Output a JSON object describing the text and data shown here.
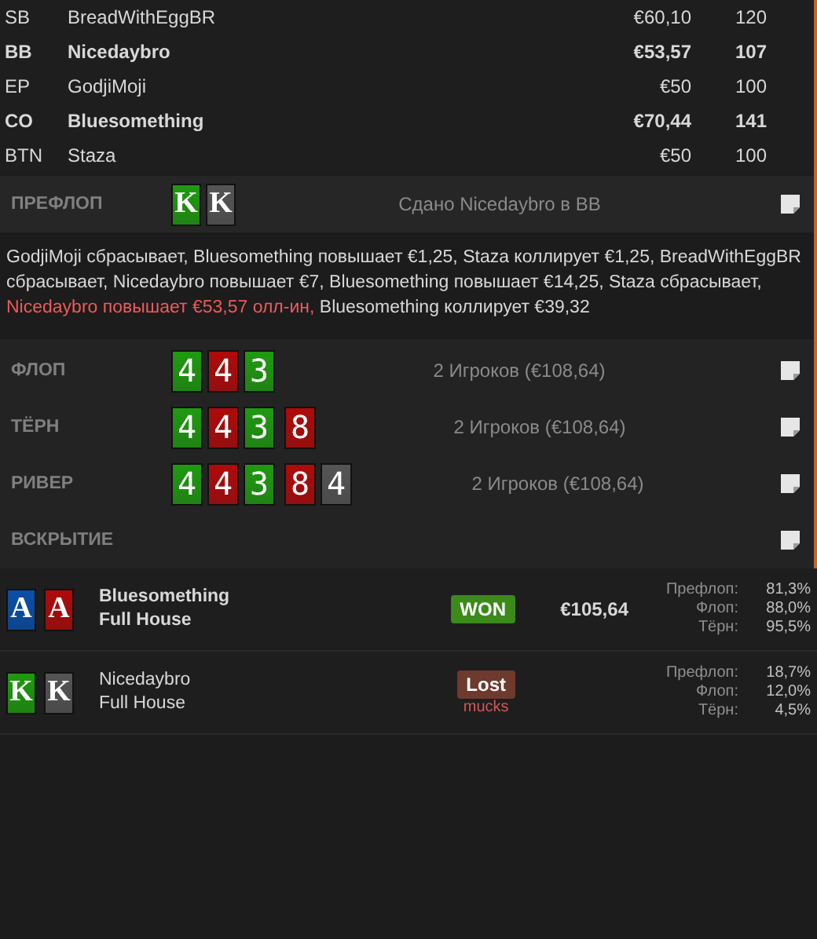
{
  "players": [
    {
      "position": "SB",
      "name": "BreadWithEggBR",
      "stack": "€60,10",
      "bb": "120",
      "highlighted": false
    },
    {
      "position": "BB",
      "name": "Nicedaybro",
      "stack": "€53,57",
      "bb": "107",
      "highlighted": true
    },
    {
      "position": "EP",
      "name": "GodjiMoji",
      "stack": "€50",
      "bb": "100",
      "highlighted": false
    },
    {
      "position": "CO",
      "name": "Bluesomething",
      "stack": "€70,44",
      "bb": "141",
      "highlighted": true
    },
    {
      "position": "BTN",
      "name": "Staza",
      "stack": "€50",
      "bb": "100",
      "highlighted": false
    }
  ],
  "preflop": {
    "label": "ПРЕФЛОП",
    "cards": [
      {
        "rank": "K",
        "color": "#1f9a10"
      },
      {
        "rank": "K",
        "color": "#555555"
      }
    ],
    "info": "Сдано Nicedaybro в BB",
    "actions": [
      {
        "text": "GodjiMoji сбрасывает, Bluesomething повышает €1,25, Staza коллирует €1,25, BreadWithEggBR сбрасывает, Nicedaybro повышает €7, Bluesomething повышает €14,25, Staza сбрасывает, ",
        "highlighted": false
      },
      {
        "text": "Nicedaybro повышает €53,57 олл-ин,",
        "highlighted": true
      },
      {
        "text": " Bluesomething коллирует €39,32",
        "highlighted": false
      }
    ]
  },
  "streets": [
    {
      "label": "ФЛОП",
      "cards": [
        {
          "rank": "4",
          "color": "#1f9a10"
        },
        {
          "rank": "4",
          "color": "#b00a0a"
        },
        {
          "rank": "3",
          "color": "#1f9a10"
        }
      ],
      "info": "2 Игроков (€108,64)"
    },
    {
      "label": "ТЁРН",
      "cards": [
        {
          "rank": "4",
          "color": "#1f9a10"
        },
        {
          "rank": "4",
          "color": "#b00a0a"
        },
        {
          "rank": "3",
          "color": "#1f9a10"
        },
        {
          "rank": "8",
          "color": "#b00a0a"
        }
      ],
      "info": "2 Игроков (€108,64)"
    },
    {
      "label": "РИВЕР",
      "cards": [
        {
          "rank": "4",
          "color": "#1f9a10"
        },
        {
          "rank": "4",
          "color": "#b00a0a"
        },
        {
          "rank": "3",
          "color": "#1f9a10"
        },
        {
          "rank": "8",
          "color": "#b00a0a"
        },
        {
          "rank": "4",
          "color": "#555555"
        }
      ],
      "info": "2 Игроков (€108,64)"
    },
    {
      "label": "ВСКРЫТИЕ"
    }
  ],
  "results": [
    {
      "name": "Bluesomething",
      "hand": "Full House",
      "highlighted": true,
      "cards": [
        {
          "rank": "A",
          "color": "#0a4fa8"
        },
        {
          "rank": "A",
          "color": "#b00a0a"
        }
      ],
      "result": {
        "kind": "won",
        "label": "WON"
      },
      "amount": "€105,64",
      "equity": [
        {
          "street": "Префлоп:",
          "value": "81,3%"
        },
        {
          "street": "Флоп:",
          "value": "88,0%"
        },
        {
          "street": "Тёрн:",
          "value": "95,5%"
        }
      ]
    },
    {
      "name": "Nicedaybro",
      "hand": "Full House",
      "highlighted": false,
      "cards": [
        {
          "rank": "K",
          "color": "#1f9a10"
        },
        {
          "rank": "K",
          "color": "#555555"
        }
      ],
      "result": {
        "kind": "lost",
        "label": "Lost"
      },
      "note": "mucks",
      "equity": [
        {
          "street": "Префлоп:",
          "value": "18,7%"
        },
        {
          "street": "Флоп:",
          "value": "12,0%"
        },
        {
          "street": "Тёрн:",
          "value": "4,5%"
        }
      ]
    }
  ]
}
